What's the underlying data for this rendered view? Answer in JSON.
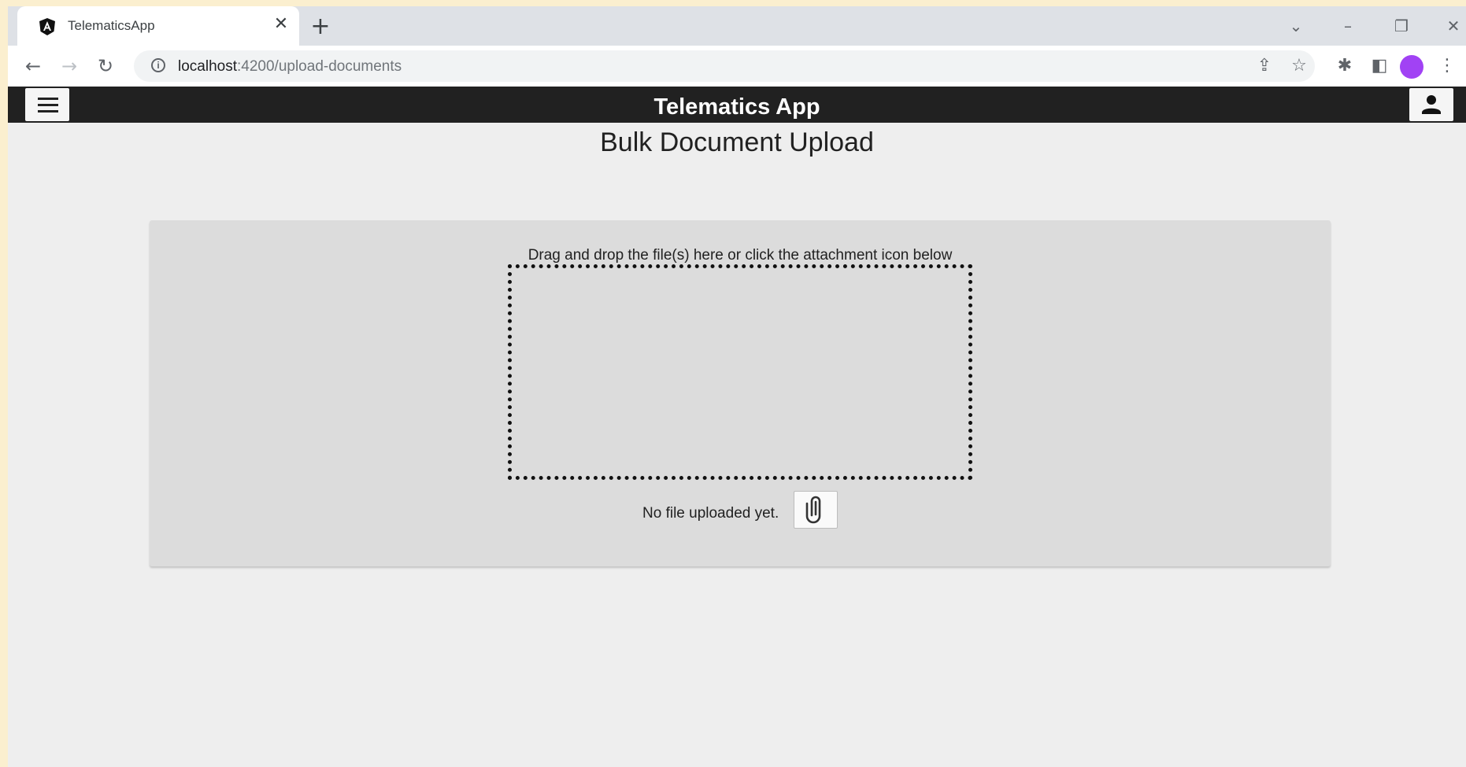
{
  "browser": {
    "tab_title": "TelematicsApp",
    "tab_close_glyph": "✕",
    "new_tab_glyph": "+",
    "url_host": "localhost",
    "url_path": ":4200/upload-documents",
    "controls": {
      "tab_search": "⌄",
      "minimize": "–",
      "restore": "❐",
      "close": "✕"
    },
    "nav": {
      "back": "←",
      "forward": "→",
      "reload": "↻"
    },
    "toolbar_icons": {
      "share": "⇪",
      "bookmark": "☆",
      "extensions": "✱",
      "side_panel": "◧",
      "menu": "⋮"
    },
    "avatar_color": "#a142f4"
  },
  "app": {
    "title": "Telematics App",
    "page_title": "Bulk Document Upload",
    "drop_hint": "Drag and drop the file(s) here or click the attachment icon below",
    "status_text": "No file uploaded yet.",
    "accent_dark": "#212121"
  }
}
